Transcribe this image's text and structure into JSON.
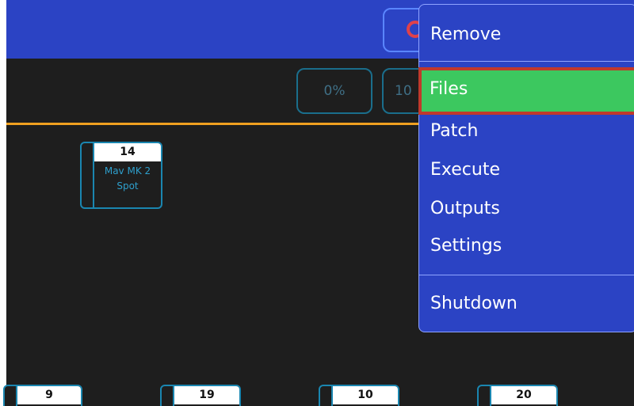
{
  "topbar": {
    "percent_buttons": [
      "0%",
      "10"
    ]
  },
  "fixtures": [
    {
      "number": "14",
      "name": "Mav MK 2 Spot"
    },
    {
      "number": "9",
      "name": ""
    },
    {
      "number": "19",
      "name": ""
    },
    {
      "number": "10",
      "name": ""
    },
    {
      "number": "20",
      "name": ""
    }
  ],
  "menu": {
    "items": [
      {
        "label": "Remove"
      },
      {
        "label": "Files",
        "selected": true
      },
      {
        "label": "Patch"
      },
      {
        "label": "Execute"
      },
      {
        "label": "Outputs"
      },
      {
        "label": "Settings"
      },
      {
        "label": "Shutdown"
      }
    ]
  },
  "colors": {
    "topbar": "#2b43c4",
    "menu_bg": "#2b43c4",
    "menu_selected": "#3cc85f",
    "selected_outline": "#c0392b",
    "orange_line": "#f0a020",
    "fixture_border": "#1a86b0"
  }
}
